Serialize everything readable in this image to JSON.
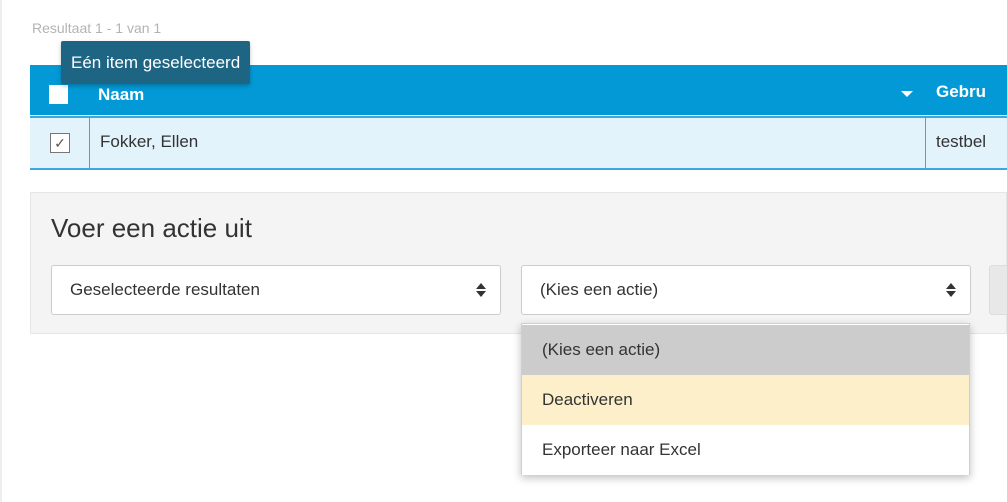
{
  "results": {
    "count_label": "Resultaat 1 - 1 van 1"
  },
  "tooltip": {
    "text": "Eén item geselecteerd"
  },
  "table": {
    "columns": [
      {
        "label": "Naam"
      },
      {
        "label": "Gebru"
      }
    ],
    "rows": [
      {
        "naam": "Fokker, Ellen",
        "col2": "testbel",
        "checked_glyph": "✓"
      }
    ]
  },
  "action_panel": {
    "title": "Voer een actie uit",
    "scope_select": {
      "value": "Geselecteerde resultaten"
    },
    "action_select": {
      "value": "(Kies een actie)"
    }
  },
  "dropdown": {
    "options": [
      {
        "label": "(Kies een actie)"
      },
      {
        "label": "Deactiveren"
      },
      {
        "label": "Exporteer naar Excel"
      }
    ]
  },
  "colors": {
    "header_bg": "#0399d6",
    "tooltip_bg": "#1e6584",
    "row_selected_bg": "#e3f3fc",
    "option_selected_bg": "#cccccc",
    "option_hover_bg": "#fcefc9"
  }
}
